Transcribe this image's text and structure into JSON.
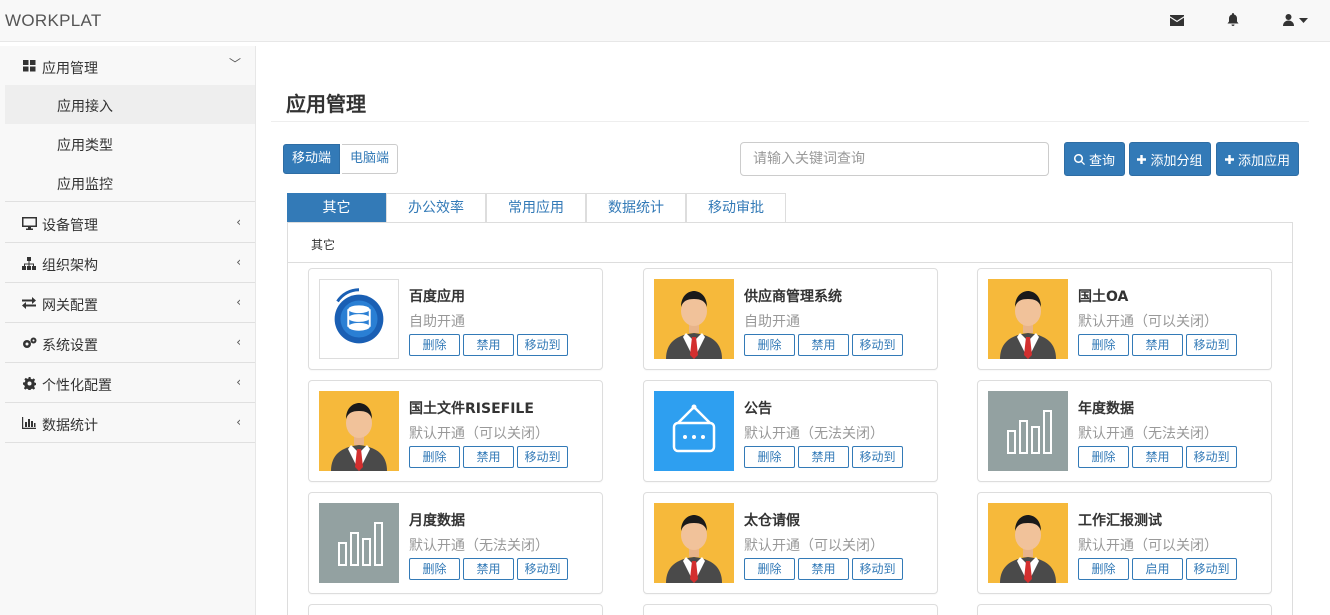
{
  "navbar": {
    "brand": "WORKPLAT",
    "icons": [
      "envelope-icon",
      "bell-icon",
      "user-icon"
    ]
  },
  "sidebar": {
    "items": [
      {
        "label": "应用管理",
        "icon": "grid-icon",
        "expanded": true,
        "children": [
          {
            "label": "应用接入",
            "active": true
          },
          {
            "label": "应用类型"
          },
          {
            "label": "应用监控"
          }
        ]
      },
      {
        "label": "设备管理",
        "icon": "desktop-icon"
      },
      {
        "label": "组织架构",
        "icon": "sitemap-icon"
      },
      {
        "label": "网关配置",
        "icon": "exchange-icon"
      },
      {
        "label": "系统设置",
        "icon": "gears-icon"
      },
      {
        "label": "个性化配置",
        "icon": "gear-icon"
      },
      {
        "label": "数据统计",
        "icon": "bar-chart-icon"
      }
    ],
    "arrow_expanded": "﹀",
    "arrow_collapsed": "‹"
  },
  "main": {
    "title": "应用管理",
    "platform_toggle": {
      "mobile": "移动端",
      "pc": "电脑端",
      "selected": "移动端"
    },
    "search": {
      "placeholder": "请输入关键词查询",
      "value": ""
    },
    "buttons": {
      "query": "查询",
      "add_group": "添加分组",
      "add_app": "添加应用"
    },
    "tabs": [
      "其它",
      "办公效率",
      "常用应用",
      "数据统计",
      "移动审批"
    ],
    "active_tab": "其它",
    "group_title": "其它",
    "card_actions": {
      "delete": "删除",
      "disable": "禁用",
      "enable": "启用",
      "move": "移动到"
    },
    "apps": [
      {
        "name": "百度应用",
        "status": "自助开通",
        "icon": "baidu-logo",
        "toggle": "禁用"
      },
      {
        "name": "供应商管理系统",
        "status": "自助开通",
        "icon": "person-avatar",
        "toggle": "禁用"
      },
      {
        "name": "国土OA",
        "status": "默认开通（可以关闭）",
        "icon": "person-avatar",
        "toggle": "禁用"
      },
      {
        "name": "国土文件RISEFILE",
        "status": "默认开通（可以关闭）",
        "icon": "person-avatar",
        "toggle": "禁用"
      },
      {
        "name": "公告",
        "status": "默认开通（无法关闭）",
        "icon": "notice-board",
        "toggle": "禁用"
      },
      {
        "name": "年度数据",
        "status": "默认开通（无法关闭）",
        "icon": "bar-chart",
        "toggle": "禁用"
      },
      {
        "name": "月度数据",
        "status": "默认开通（无法关闭）",
        "icon": "bar-chart",
        "toggle": "禁用"
      },
      {
        "name": "太仓请假",
        "status": "默认开通（可以关闭）",
        "icon": "person-avatar",
        "toggle": "禁用"
      },
      {
        "name": "工作汇报测试",
        "status": "默认开通（可以关闭）",
        "icon": "person-avatar",
        "toggle": "启用"
      }
    ],
    "colors": {
      "primary": "#337ab7",
      "avatar_bg": "#f6b93b",
      "notice_bg": "#2e9ff0",
      "chart_bg": "#93a1a1"
    }
  }
}
